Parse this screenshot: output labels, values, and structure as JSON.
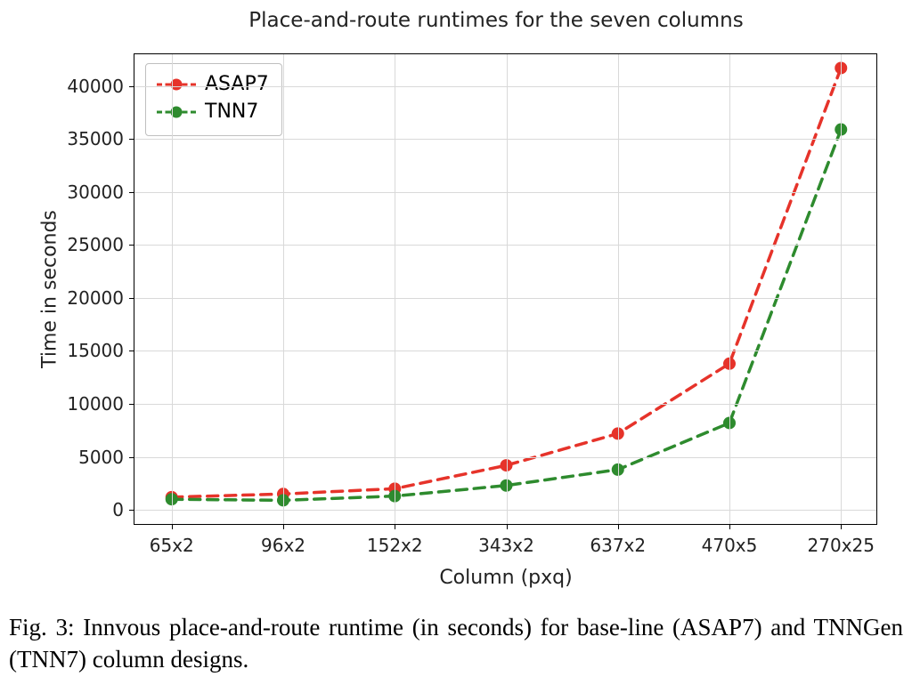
{
  "chart_data": {
    "type": "line",
    "title": "Place-and-route runtimes for the seven columns",
    "xlabel": "Column (pxq)",
    "ylabel": "Time in seconds",
    "ylim": [
      -1500,
      43000
    ],
    "yticks": [
      0,
      5000,
      10000,
      15000,
      20000,
      25000,
      30000,
      35000,
      40000
    ],
    "categories": [
      "65x2",
      "96x2",
      "152x2",
      "343x2",
      "637x2",
      "470x5",
      "270x25"
    ],
    "series": [
      {
        "name": "ASAP7",
        "color": "#e6332a",
        "values": [
          1200,
          1500,
          2000,
          4200,
          7200,
          13800,
          41700
        ]
      },
      {
        "name": "TNN7",
        "color": "#2e8b2e",
        "values": [
          1000,
          900,
          1300,
          2300,
          3800,
          8200,
          35900
        ]
      }
    ],
    "legend_position": "upper-left",
    "grid": true,
    "linestyle": "dashed",
    "marker": "circle"
  },
  "caption_prefix": "Fig. 3: ",
  "caption_body": "Innvous place-and-route runtime (in seconds) for base-line (ASAP7) and TNNGen (TNN7) column designs."
}
